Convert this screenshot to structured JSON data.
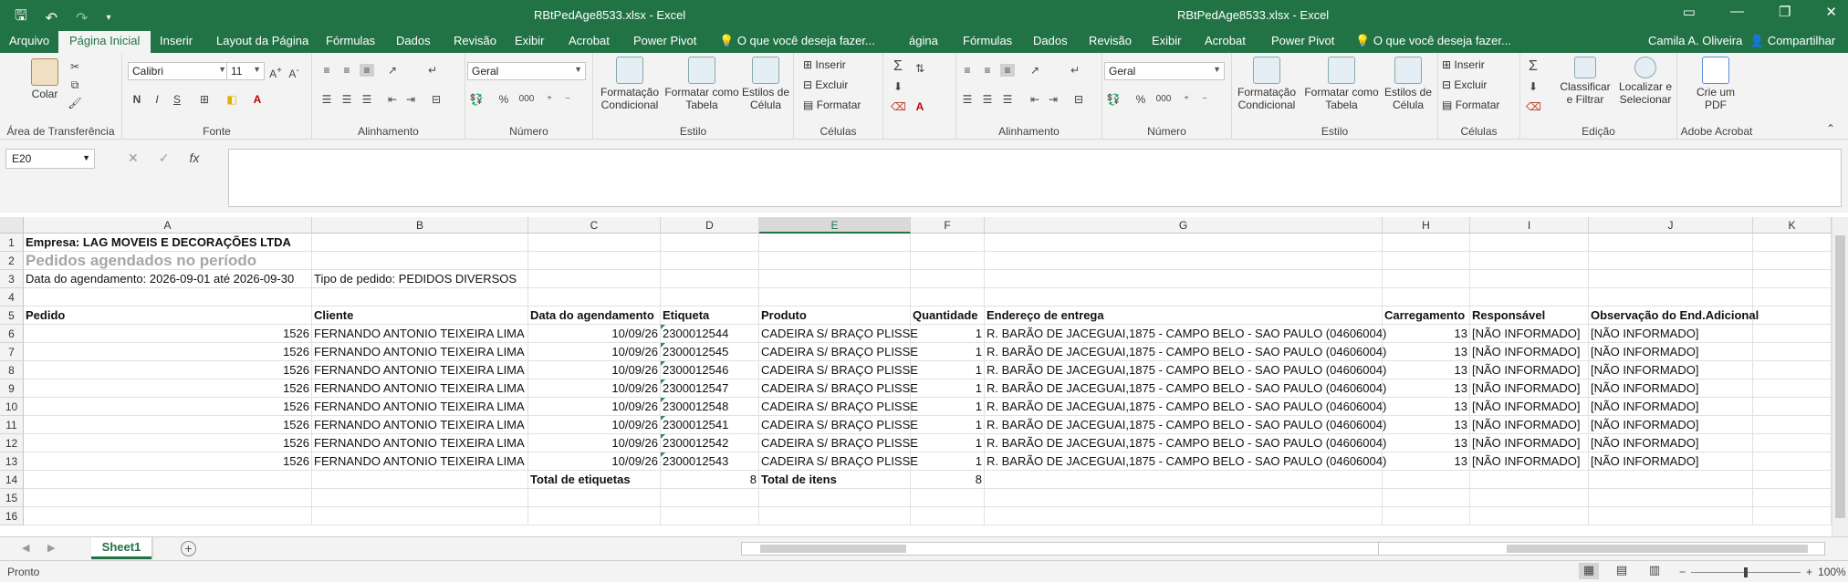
{
  "titlebar": {
    "title_left": "RBtPedAge8533.xlsx - Excel",
    "title_right": "RBtPedAge8533.xlsx - Excel"
  },
  "menu": {
    "tabs_left": [
      "Arquivo",
      "Página Inicial",
      "Inserir",
      "Layout da Página",
      "Fórmulas",
      "Dados",
      "Revisão",
      "Exibir",
      "Acrobat",
      "Power Pivot",
      "O que você deseja fazer..."
    ],
    "tabs_right": [
      "ágina",
      "Fórmulas",
      "Dados",
      "Revisão",
      "Exibir",
      "Acrobat",
      "Power Pivot",
      "O que você deseja fazer..."
    ],
    "user": "Camila A. Oliveira",
    "share": "Compartilhar"
  },
  "ribbon": {
    "clipboard": {
      "paste": "Colar",
      "label": "Área de Transferência"
    },
    "font": {
      "name": "Calibri",
      "size": "11",
      "bold": "N",
      "italic": "I",
      "underline": "S",
      "label": "Fonte"
    },
    "alignment": {
      "label": "Alinhamento"
    },
    "number": {
      "format": "Geral",
      "percent": "%",
      "thousands": "000",
      "label": "Número"
    },
    "styles": {
      "conditional": "Formatação Condicional",
      "as_table": "Formatar como Tabela",
      "cell_styles": "Estilos de Célula",
      "label": "Estilo"
    },
    "cells": {
      "insert": "Inserir",
      "delete": "Excluir",
      "format": "Formatar",
      "label": "Células"
    },
    "alignment2": {
      "label": "Alinhamento"
    },
    "number2": {
      "format": "Geral",
      "percent": "%",
      "thousands": "000",
      "label": "Número"
    },
    "styles2": {
      "conditional": "Formatação Condicional",
      "as_table": "Formatar como Tabela",
      "cell_styles": "Estilos de Célula",
      "label": "Estilo"
    },
    "cells2": {
      "insert": "Inserir",
      "delete": "Excluir",
      "format": "Formatar",
      "label": "Células"
    },
    "editing": {
      "sort": "Classificar e Filtrar",
      "find": "Localizar e Selecionar",
      "label": "Edição"
    },
    "acrobat": {
      "create_pdf": "Crie um PDF",
      "label": "Adobe Acrobat"
    }
  },
  "formula": {
    "namebox": "E20",
    "cancel": "✕",
    "confirm": "✓",
    "fx": "fx",
    "value": ""
  },
  "columns": [
    "A",
    "B",
    "C",
    "D",
    "E",
    "F",
    "G",
    "H",
    "I",
    "J",
    "K"
  ],
  "rows": [
    "1",
    "2",
    "3",
    "4",
    "5",
    "6",
    "7",
    "8",
    "9",
    "10",
    "11",
    "12",
    "13",
    "14",
    "15",
    "16"
  ],
  "sheet": {
    "company": "Empresa: LAG MOVEIS E DECORAÇÕES LTDA",
    "report_title": "Pedidos agendados no período",
    "date_range": "Data do agendamento: 2026-09-01 até 2026-09-30",
    "order_type": "Tipo de pedido: PEDIDOS DIVERSOS",
    "headers": [
      "Pedido",
      "Cliente",
      "Data do agendamento",
      "Etiqueta",
      "Produto",
      "Quantidade",
      "Endereço de entrega",
      "Carregamento",
      "Responsável",
      "Observação do End.Adicional"
    ],
    "data_rows": [
      [
        "1526",
        "FERNANDO ANTONIO TEIXEIRA LIMA",
        "10/09/26",
        "2300012544",
        "CADEIRA S/ BRAÇO PLISSE",
        "1",
        "R. BARÃO DE JACEGUAI,1875 - CAMPO BELO - SAO PAULO (04606004)",
        "13",
        "[NÃO INFORMADO]",
        "[NÃO INFORMADO]"
      ],
      [
        "1526",
        "FERNANDO ANTONIO TEIXEIRA LIMA",
        "10/09/26",
        "2300012545",
        "CADEIRA S/ BRAÇO PLISSE",
        "1",
        "R. BARÃO DE JACEGUAI,1875 - CAMPO BELO - SAO PAULO (04606004)",
        "13",
        "[NÃO INFORMADO]",
        "[NÃO INFORMADO]"
      ],
      [
        "1526",
        "FERNANDO ANTONIO TEIXEIRA LIMA",
        "10/09/26",
        "2300012546",
        "CADEIRA S/ BRAÇO PLISSE",
        "1",
        "R. BARÃO DE JACEGUAI,1875 - CAMPO BELO - SAO PAULO (04606004)",
        "13",
        "[NÃO INFORMADO]",
        "[NÃO INFORMADO]"
      ],
      [
        "1526",
        "FERNANDO ANTONIO TEIXEIRA LIMA",
        "10/09/26",
        "2300012547",
        "CADEIRA S/ BRAÇO PLISSE",
        "1",
        "R. BARÃO DE JACEGUAI,1875 - CAMPO BELO - SAO PAULO (04606004)",
        "13",
        "[NÃO INFORMADO]",
        "[NÃO INFORMADO]"
      ],
      [
        "1526",
        "FERNANDO ANTONIO TEIXEIRA LIMA",
        "10/09/26",
        "2300012548",
        "CADEIRA S/ BRAÇO PLISSE",
        "1",
        "R. BARÃO DE JACEGUAI,1875 - CAMPO BELO - SAO PAULO (04606004)",
        "13",
        "[NÃO INFORMADO]",
        "[NÃO INFORMADO]"
      ],
      [
        "1526",
        "FERNANDO ANTONIO TEIXEIRA LIMA",
        "10/09/26",
        "2300012541",
        "CADEIRA S/ BRAÇO PLISSE",
        "1",
        "R. BARÃO DE JACEGUAI,1875 - CAMPO BELO - SAO PAULO (04606004)",
        "13",
        "[NÃO INFORMADO]",
        "[NÃO INFORMADO]"
      ],
      [
        "1526",
        "FERNANDO ANTONIO TEIXEIRA LIMA",
        "10/09/26",
        "2300012542",
        "CADEIRA S/ BRAÇO PLISSE",
        "1",
        "R. BARÃO DE JACEGUAI,1875 - CAMPO BELO - SAO PAULO (04606004)",
        "13",
        "[NÃO INFORMADO]",
        "[NÃO INFORMADO]"
      ],
      [
        "1526",
        "FERNANDO ANTONIO TEIXEIRA LIMA",
        "10/09/26",
        "2300012543",
        "CADEIRA S/ BRAÇO PLISSE",
        "1",
        "R. BARÃO DE JACEGUAI,1875 - CAMPO BELO - SAO PAULO (04606004)",
        "13",
        "[NÃO INFORMADO]",
        "[NÃO INFORMADO]"
      ]
    ],
    "totals": {
      "labels_label": "Total de etiquetas",
      "labels_value": "8",
      "items_label": "Total de itens",
      "items_value": "8"
    }
  },
  "sheetbar": {
    "tab": "Sheet1",
    "add": "+"
  },
  "status": {
    "ready": "Pronto",
    "zoom": "100%",
    "zoom_minus": "−",
    "zoom_plus": "+"
  },
  "accent": "#217346"
}
